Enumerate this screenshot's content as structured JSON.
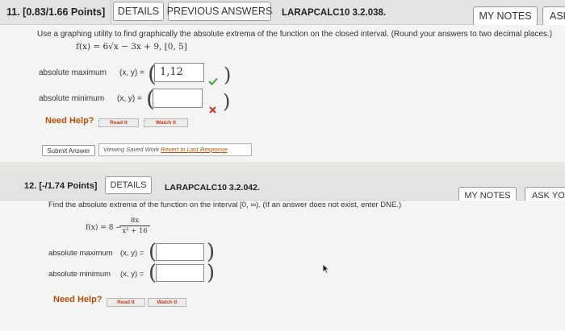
{
  "q11": {
    "number_label": "11. [0.83/1.66 Points]",
    "details": "DETAILS",
    "previous_answers": "PREVIOUS ANSWERS",
    "code": "LARAPCALC10 3.2.038.",
    "my_notes": "MY NOTES",
    "ask": "ASK",
    "instructions": "Use a graphing utility to find graphically the absolute extrema of the function on the closed interval. (Round your answers to two decimal places.)",
    "function": "f(x) = 6√x − 3x + 9,   [0, 5]",
    "abs_max_label": "absolute maximum",
    "abs_max_xy": "(x, y) =",
    "abs_max_value": "1,12",
    "abs_min_label": "absolute minimum",
    "abs_min_xy": "(x, y) =",
    "abs_min_value": "",
    "need_help": "Need Help?",
    "read_it": "Read It",
    "watch_it": "Watch It",
    "submit_answer": "Submit Answer",
    "viewing_text": "Viewing Saved Work",
    "revert_link": "Revert to Last Response",
    "check_color": "#3aa53a",
    "cross_color": "#c0392b"
  },
  "q12": {
    "number_label": "12. [-/1.74 Points]",
    "details": "DETAILS",
    "code": "LARAPCALC10 3.2.042.",
    "my_notes": "MY NOTES",
    "ask": "ASK YOU",
    "instructions": "Find the absolute extrema of the function on the interval [0, ∞). (If an answer does not exist, enter DNE.)",
    "function_lhs": "f(x) = 8 −",
    "function_num": "8x",
    "function_den": "x² + 16",
    "abs_max_label": "absolute maximum",
    "abs_max_xy": "(x, y) =",
    "abs_min_label": "absolute minimum",
    "abs_min_xy": "(x, y) =",
    "need_help": "Need Help?",
    "read_it": "Read It",
    "watch_it": "Watch It"
  }
}
